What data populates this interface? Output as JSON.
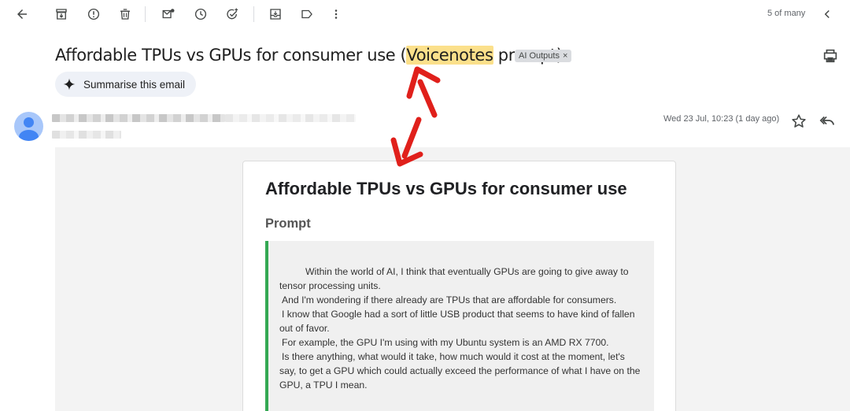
{
  "toolbar": {
    "icons": [
      "back-arrow-icon",
      "archive-icon",
      "report-spam-icon",
      "delete-icon",
      "mark-unread-icon",
      "snooze-icon",
      "add-task-icon",
      "move-to-icon",
      "label-icon",
      "more-options-icon"
    ],
    "pager_text": "5 of many",
    "prev_icon": "chevron-left-icon"
  },
  "email": {
    "subject_before": "Affordable TPUs vs GPUs for consumer use (",
    "subject_highlight": "Voicenotes",
    "subject_after": " prompt)",
    "label_chip": "AI Outputs",
    "label_chip_close": "×",
    "summarise_label": "Summarise this email",
    "date": "Wed 23 Jul, 10:23 (1 day ago)",
    "highlight_color": "#fbe08b"
  },
  "content": {
    "title": "Affordable TPUs vs GPUs for consumer use",
    "section_heading": "Prompt",
    "prompt_lines": [
      "Within the world of AI, I think that eventually GPUs are going to give away to tensor processing units.",
      "And I'm wondering if there already are TPUs that are affordable for consumers.",
      "I know that Google had a sort of little USB product that seems to have kind of fallen out of favor.",
      "For example, the GPU I'm using with my Ubuntu system is an AMD RX 7700.",
      "Is there anything, what would it take, how much would it cost at the moment, let's say, to get a GPU which could actually exceed the performance of what I have on the GPU, a TPU I mean."
    ],
    "quote_accent": "#34a853"
  },
  "annotation": {
    "arrow_color": "#e0201b"
  }
}
